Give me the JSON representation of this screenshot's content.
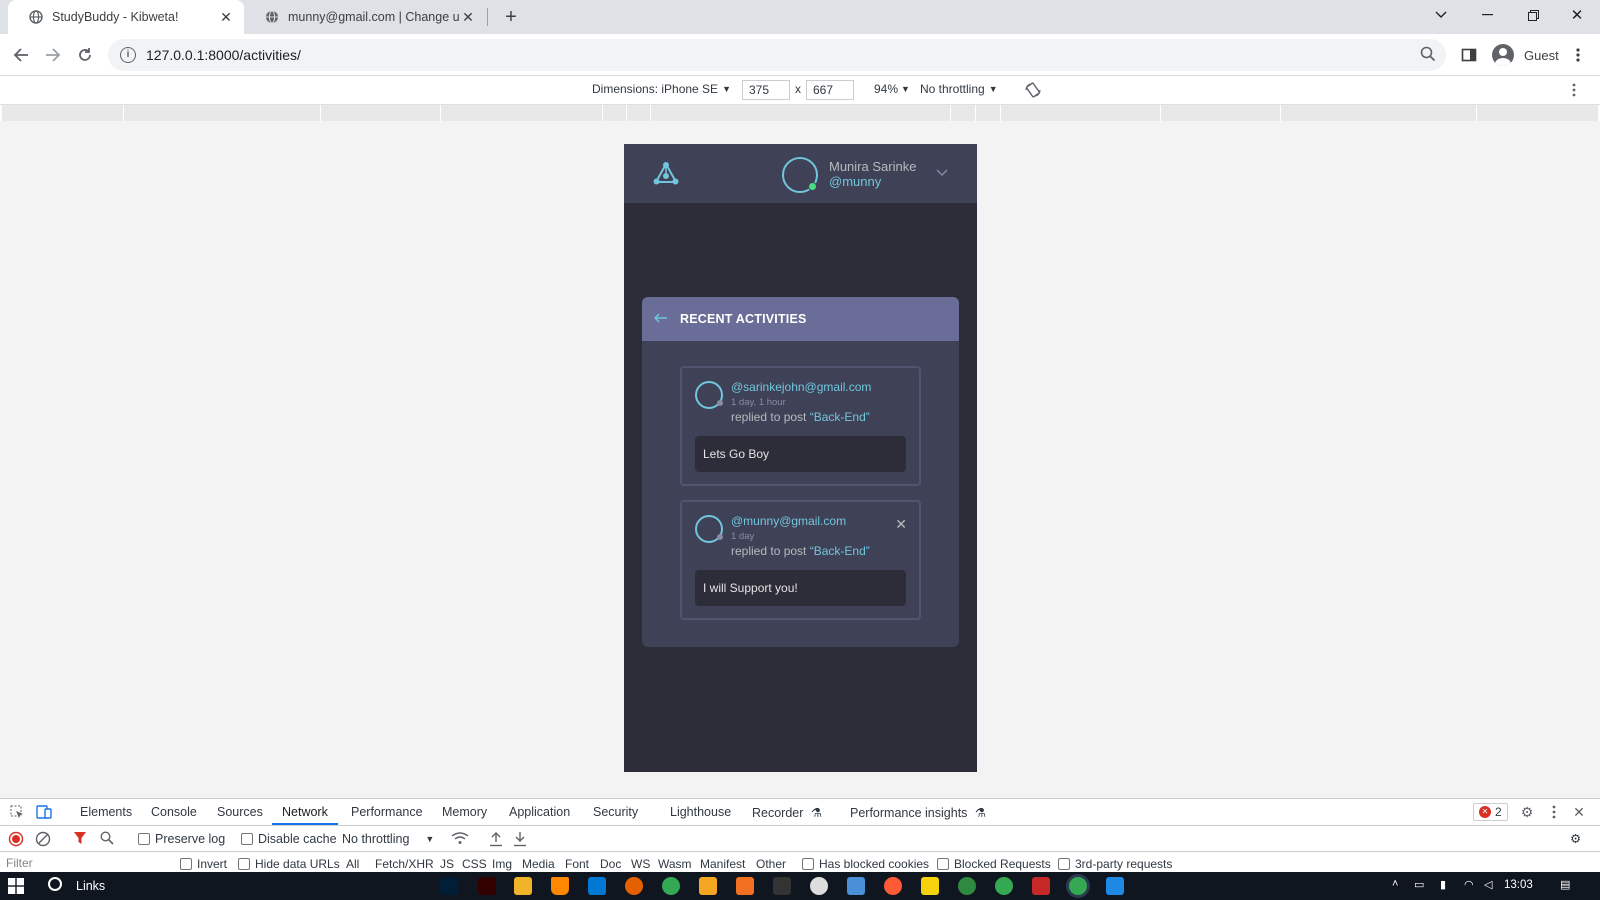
{
  "browser": {
    "tabs": [
      {
        "title": "StudyBuddy - Kibweta!",
        "active": true
      },
      {
        "title": "munny@gmail.com | Change use",
        "active": false
      }
    ],
    "url": "127.0.0.1:8000/activities/",
    "profile": "Guest"
  },
  "device_toolbar": {
    "dimensions_label": "Dimensions: iPhone SE",
    "width": "375",
    "height": "667",
    "times": "x",
    "zoom": "94%",
    "throttling": "No throttling"
  },
  "app": {
    "user": {
      "name": "Munira Sarinke",
      "handle": "@munny"
    },
    "card_title": "RECENT ACTIVITIES",
    "activities": [
      {
        "user": "@sarinkejohn@gmail.com",
        "time": "1 day, 1 hour",
        "action": "replied to post",
        "post": "“Back-End”",
        "body": "Lets Go Boy"
      },
      {
        "user": "@munny@gmail.com",
        "time": "1 day",
        "action": "replied to post",
        "post": "“Back-End”",
        "body": "I will Support you!"
      }
    ]
  },
  "devtools": {
    "tabs": [
      "Elements",
      "Console",
      "Sources",
      "Network",
      "Performance",
      "Memory",
      "Application",
      "Security",
      "Lighthouse",
      "Recorder",
      "Performance insights"
    ],
    "active_tab": "Network",
    "error_count": "2",
    "toolbar": {
      "preserve_log": "Preserve log",
      "disable_cache": "Disable cache",
      "throttling": "No throttling"
    },
    "filter": {
      "placeholder": "Filter",
      "invert": "Invert",
      "hide_data_urls": "Hide data URLs",
      "types": [
        "All",
        "Fetch/XHR",
        "JS",
        "CSS",
        "Img",
        "Media",
        "Font",
        "Doc",
        "WS",
        "Wasm",
        "Manifest",
        "Other"
      ],
      "has_blocked_cookies": "Has blocked cookies",
      "blocked_requests": "Blocked Requests",
      "third_party": "3rd-party requests"
    }
  },
  "taskbar": {
    "search_label": "Links",
    "time": "13:03"
  }
}
